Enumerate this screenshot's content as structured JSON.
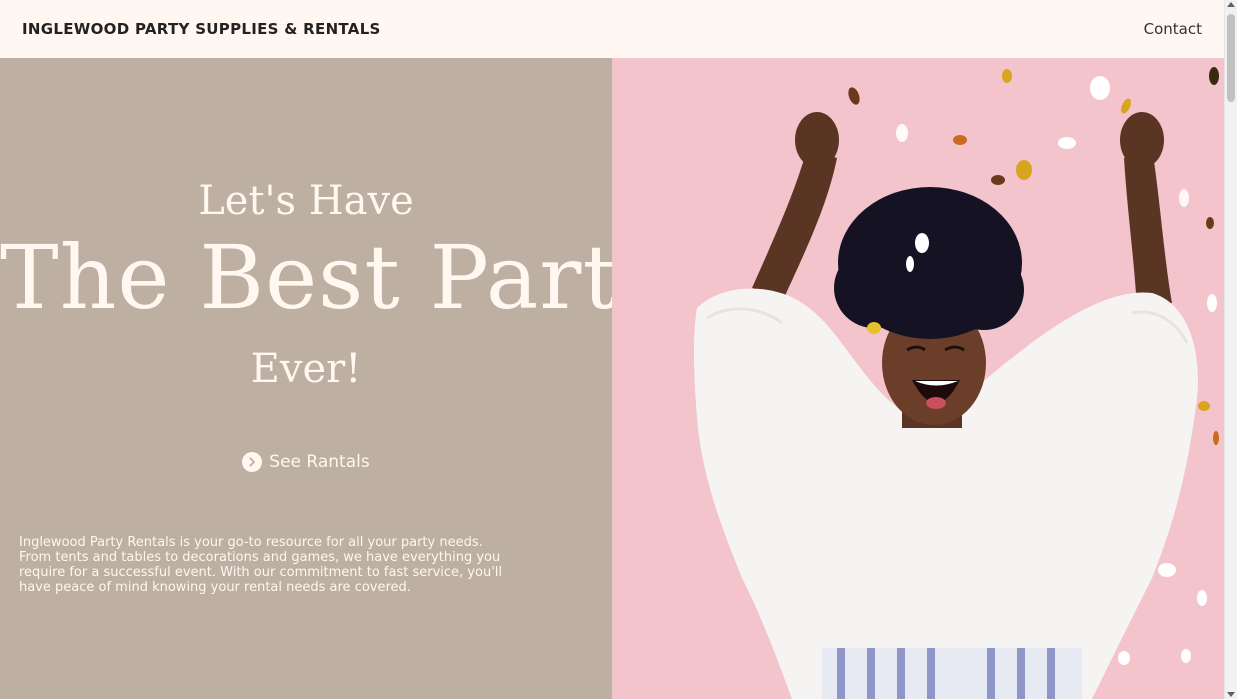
{
  "header": {
    "brand": "INGLEWOOD PARTY SUPPLIES & RENTALS",
    "contact_label": "Contact"
  },
  "hero": {
    "line1": "Let's Have",
    "line2": "The Best Party",
    "line3": "Ever!",
    "cta_label": "See Rantals",
    "cta_icon": "chevron-right-circle-icon",
    "description": "Inglewood Party Rentals is your go-to resource for all your party needs. From tents and tables to decorations and games, we have everything you require for a successful event. With our commitment to fast service, you'll have peace of mind knowing your rental needs are covered."
  },
  "colors": {
    "header_bg": "#fff7f2",
    "left_panel_bg": "#bdafa1",
    "hero_text": "#fff7f0",
    "image_bg": "#f3c4cb"
  }
}
